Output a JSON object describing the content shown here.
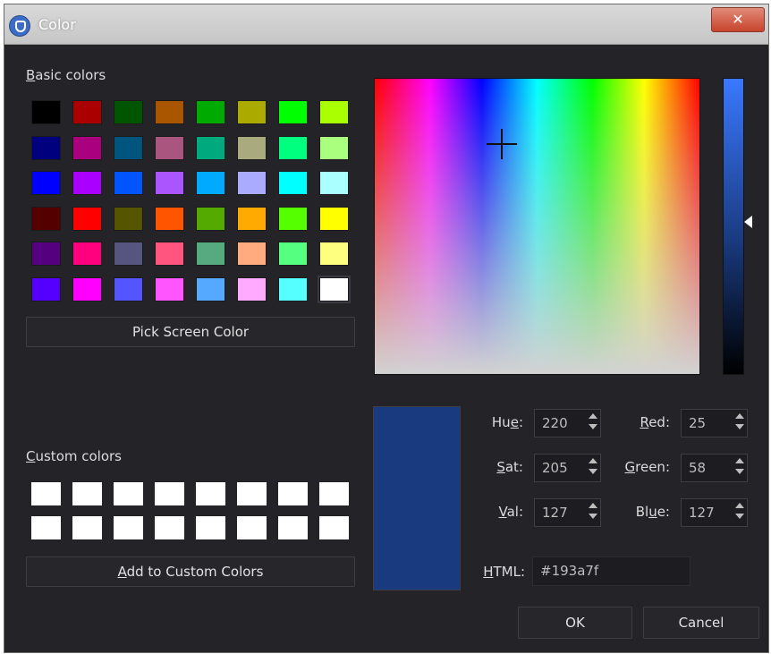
{
  "window": {
    "title": "Color"
  },
  "basic_colors": {
    "label_prefix": "B",
    "label_rest": "asic colors",
    "rows": [
      [
        "#000000",
        "#aa0000",
        "#005500",
        "#aa5500",
        "#00aa00",
        "#aaaa00",
        "#00ff00",
        "#aaff00"
      ],
      [
        "#00007f",
        "#aa007f",
        "#00557f",
        "#aa557f",
        "#00aa7f",
        "#aaaa7f",
        "#00ff7f",
        "#aaff7f"
      ],
      [
        "#0000ff",
        "#aa00ff",
        "#0055ff",
        "#aa55ff",
        "#00aaff",
        "#aaaaff",
        "#00ffff",
        "#aaffff"
      ],
      [
        "#550000",
        "#ff0000",
        "#555500",
        "#ff5500",
        "#55aa00",
        "#ffaa00",
        "#55ff00",
        "#ffff00"
      ],
      [
        "#55007f",
        "#ff007f",
        "#55557f",
        "#ff557f",
        "#55aa7f",
        "#ffaa7f",
        "#55ff7f",
        "#ffff7f"
      ],
      [
        "#5500ff",
        "#ff00ff",
        "#5555ff",
        "#ff55ff",
        "#55aaff",
        "#ffaaff",
        "#55ffff",
        "#ffffff"
      ]
    ]
  },
  "pick_screen_color": "Pick Screen Color",
  "custom_colors": {
    "label_prefix": "C",
    "label_rest": "ustom colors",
    "count": 16
  },
  "add_to_custom": {
    "prefix": "A",
    "rest": "dd to Custom Colors"
  },
  "current_color": "#193a7f",
  "fields": {
    "hue": {
      "label_a": "Hu",
      "label_u": "e",
      "label_b": ":",
      "value": "220"
    },
    "sat": {
      "label_a": "",
      "label_u": "S",
      "label_b": "at:",
      "value": "205"
    },
    "val": {
      "label_a": "",
      "label_u": "V",
      "label_b": "al:",
      "value": "127"
    },
    "red": {
      "label_a": "",
      "label_u": "R",
      "label_b": "ed:",
      "value": "25"
    },
    "green": {
      "label_a": "",
      "label_u": "G",
      "label_b": "reen:",
      "value": "58"
    },
    "blue": {
      "label_a": "Bl",
      "label_u": "u",
      "label_b": "e:",
      "value": "127"
    },
    "html": {
      "label_a": "",
      "label_u": "H",
      "label_b": "TML:",
      "value": "#193a7f"
    }
  },
  "buttons": {
    "ok": "OK",
    "cancel": "Cancel",
    "close": "✕"
  }
}
